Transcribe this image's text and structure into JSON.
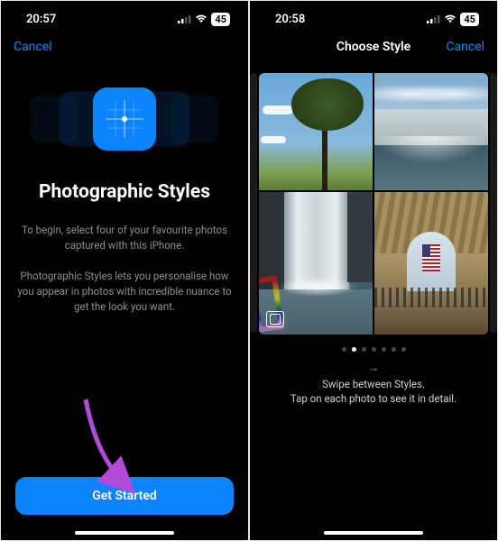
{
  "colors": {
    "accent": "#0a84ff"
  },
  "screen1": {
    "status": {
      "time": "20:57",
      "battery": "45"
    },
    "nav": {
      "cancel": "Cancel"
    },
    "title": "Photographic Styles",
    "intro": "To begin, select four of your favourite photos captured with this iPhone.",
    "desc": "Photographic Styles lets you personalise how you appear in photos with incredible nuance to get the look you want.",
    "cta": "Get Started"
  },
  "screen2": {
    "status": {
      "time": "20:58",
      "battery": "45"
    },
    "nav": {
      "title": "Choose Style",
      "cancel": "Cancel"
    },
    "pager": {
      "count": 7,
      "active": 1
    },
    "hint_line1": "Swipe between Styles.",
    "hint_line2": "Tap on each photo to see it in detail.",
    "photos": [
      "tree-sky",
      "niagara-side",
      "waterfall-front",
      "station-interior"
    ]
  }
}
